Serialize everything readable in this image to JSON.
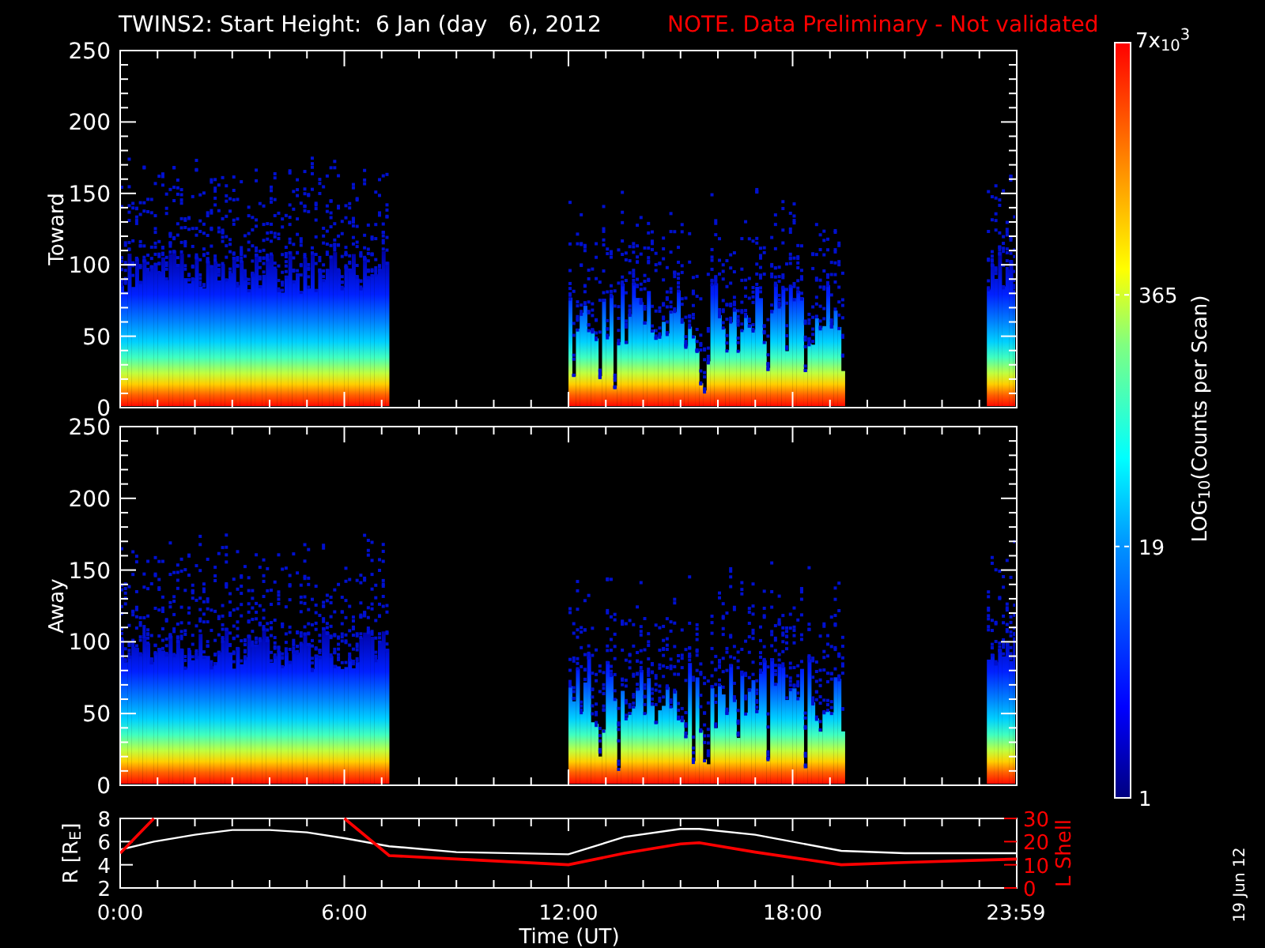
{
  "title": {
    "text": "TWINS2: Start Height:  6 Jan (day   6), 2012",
    "note": "NOTE. Data Preliminary - Not validated"
  },
  "panels": [
    {
      "ylabel": "Toward",
      "yticks": [
        "250",
        "200",
        "150",
        "100",
        "50",
        "0"
      ]
    },
    {
      "ylabel": "Away",
      "yticks": [
        "250",
        "200",
        "150",
        "100",
        "50",
        "0"
      ]
    }
  ],
  "colorbar": {
    "label": "LOG$_{10}$(Counts per Scan)",
    "ticks": [
      "7x$_{10}$$^{3}$",
      "365",
      "19",
      "1"
    ]
  },
  "ephemeris": {
    "chart_data": {
      "type": "line",
      "xlabel": "Time (UT)",
      "ylabel": "R [R$_{E}$]",
      "x": [
        0,
        0.9,
        2,
        3,
        4,
        5,
        6,
        7.2,
        9,
        12,
        13.5,
        15,
        15.5,
        17,
        19.3,
        21,
        24
      ],
      "series": [
        {
          "color": "#ffffff",
          "values": [
            5.3,
            6.0,
            6.6,
            7.0,
            7.0,
            6.8,
            6.3,
            5.6,
            5.1,
            4.9,
            6.4,
            7.1,
            7.1,
            6.6,
            5.2,
            5.0,
            5.0
          ]
        }
      ],
      "xlim": [
        0,
        24
      ],
      "ylim": [
        2,
        8
      ],
      "yticks": [
        8,
        6,
        4,
        2
      ],
      "xticks": [
        {
          "value": 0,
          "label": "0:00"
        },
        {
          "value": 6,
          "label": "6:00"
        },
        {
          "value": 12,
          "label": "12:00"
        },
        {
          "value": 18,
          "label": "18:00"
        },
        {
          "value": 23.98,
          "label": "23:59"
        }
      ]
    },
    "l_shell_chart": {
      "chart_data": {
        "type": "line",
        "ylabel": "L Shell",
        "x": [
          0,
          0.9,
          3,
          6,
          7.2,
          9,
          12,
          13.5,
          15,
          15.5,
          17,
          19.3,
          21,
          24
        ],
        "series": [
          {
            "color": "#ff0000",
            "values": [
              15,
              30,
              null,
              30,
              14,
              12.5,
              10,
              15,
              19,
              19.5,
              15.5,
              10,
              11,
              12.5
            ]
          }
        ],
        "xlim": [
          0,
          24
        ],
        "ylim": [
          0,
          30
        ],
        "yticks": [
          30,
          20,
          10,
          0
        ]
      }
    }
  },
  "date_stamp": "19 Jun 12"
}
